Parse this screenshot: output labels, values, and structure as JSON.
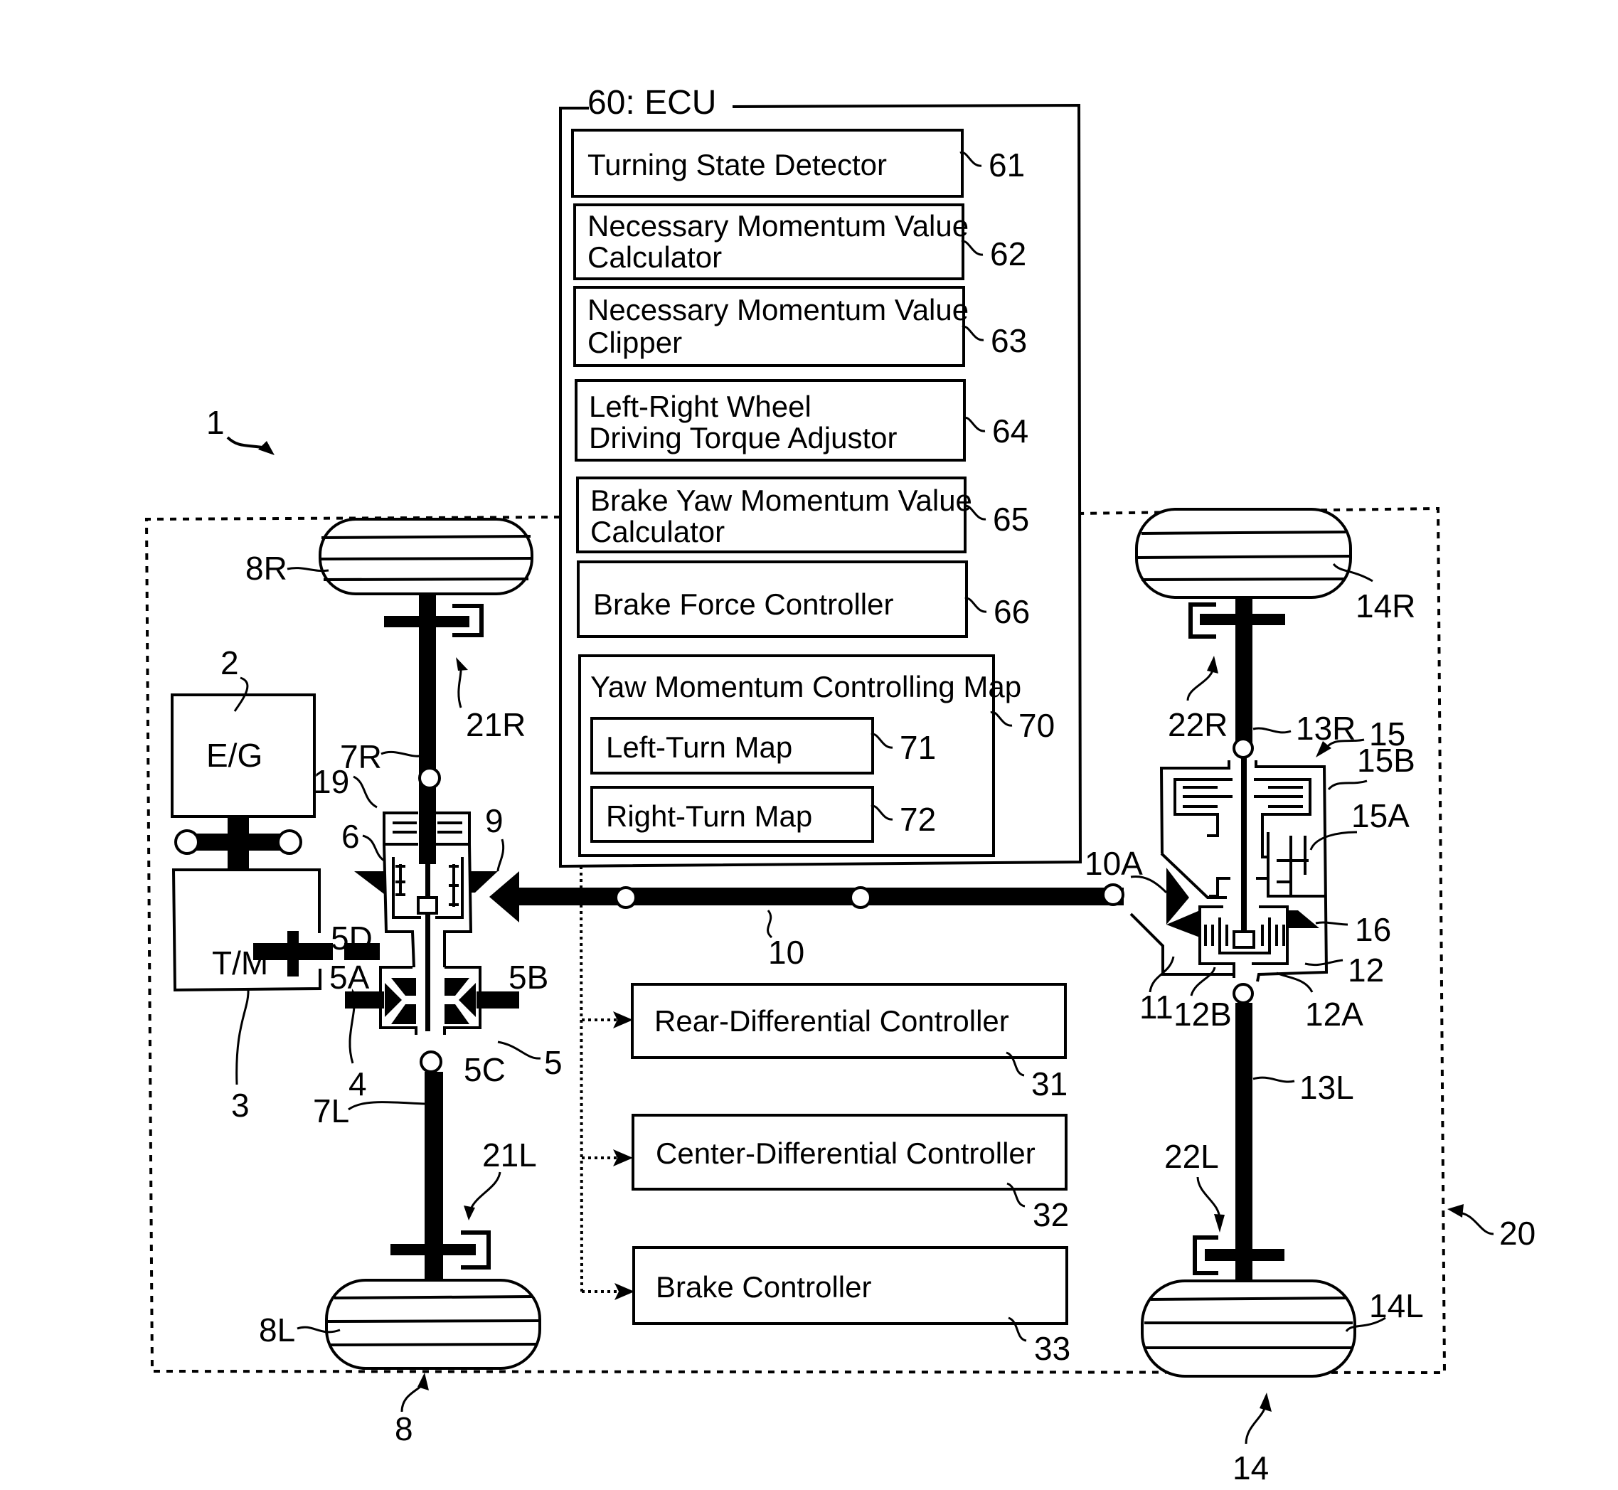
{
  "figure": {
    "vehicle_ref": "1",
    "powertrain_region_ref": "20",
    "front_axle_ref": "8",
    "rear_axle_ref": "14"
  },
  "ecu": {
    "title": "60: ECU",
    "modules": [
      {
        "lines": [
          "Turning State Detector"
        ],
        "ref": "61"
      },
      {
        "lines": [
          "Necessary Momentum Value",
          "Calculator"
        ],
        "ref": "62"
      },
      {
        "lines": [
          "Necessary Momentum Value",
          "Clipper"
        ],
        "ref": "63"
      },
      {
        "lines": [
          "Left-Right Wheel",
          "Driving Torque Adjustor"
        ],
        "ref": "64"
      },
      {
        "lines": [
          "Brake Yaw Momentum Value",
          "Calculator"
        ],
        "ref": "65"
      },
      {
        "lines": [
          "Brake Force Controller"
        ],
        "ref": "66"
      }
    ],
    "map": {
      "title": "Yaw Momentum Controlling Map",
      "ref": "70",
      "items": [
        {
          "label": "Left-Turn Map",
          "ref": "71"
        },
        {
          "label": "Right-Turn Map",
          "ref": "72"
        }
      ]
    }
  },
  "controllers": [
    {
      "label": "Rear-Differential Controller",
      "ref": "31"
    },
    {
      "label": "Center-Differential Controller",
      "ref": "32"
    },
    {
      "label": "Brake Controller",
      "ref": "33"
    }
  ],
  "components": {
    "engine": {
      "label": "E/G",
      "ref": "2"
    },
    "transmission": {
      "label": "T/M",
      "ref": "3"
    },
    "transfer": "4",
    "front_diff": "5",
    "front_diff_parts": [
      "5A",
      "5B",
      "5C",
      "5D"
    ],
    "front_diff_unit": "6",
    "front_axle_right": "7R",
    "front_axle_left": "7L",
    "front_wheel_right": "8R",
    "front_wheel_left": "8L",
    "front_bevel": "9",
    "propeller_shaft": "10",
    "propeller_pinion": "10A",
    "rear_ring_gear": "11",
    "rear_diff": "12",
    "rear_diff_parts": [
      "12A",
      "12B"
    ],
    "rear_axle_right": "13R",
    "rear_axle_left": "13L",
    "rear_wheel_right": "14R",
    "rear_wheel_left": "14L",
    "rear_clutch_unit": "15",
    "rear_clutch_parts": [
      "15A",
      "15B"
    ],
    "rear_bevel": "16",
    "front_clutch": "19",
    "brake_front_right": "21R",
    "brake_front_left": "21L",
    "brake_rear_right": "22R",
    "brake_rear_left": "22L"
  }
}
